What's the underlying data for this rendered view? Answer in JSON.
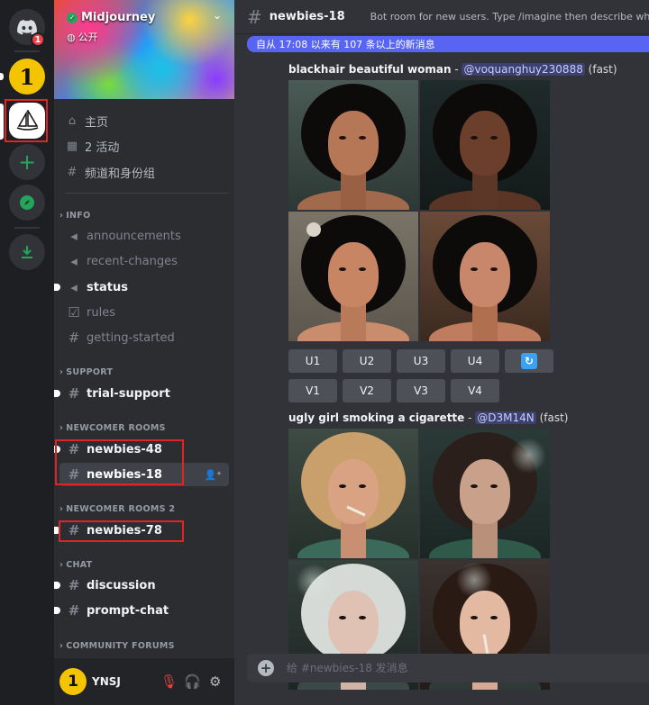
{
  "rail": {
    "home_badge": "1",
    "midjourney_label": "Midjourney",
    "server_one_glyph": "1"
  },
  "sidebar": {
    "server_name": "Midjourney",
    "visibility": "公开",
    "nav": [
      {
        "icon": "home-icon",
        "label": "主页"
      },
      {
        "icon": "calendar-icon",
        "label": "2 活动"
      },
      {
        "icon": "channels-roles-icon",
        "label": "频道和身份组"
      }
    ],
    "categories": {
      "info": "INFO",
      "support": "SUPPORT",
      "newcomer": "NEWCOMER ROOMS",
      "newcomer2": "NEWCOMER ROOMS 2",
      "chat": "CHAT",
      "forums": "COMMUNITY FORUMS"
    },
    "channels": {
      "announcements": "announcements",
      "recent_changes": "recent-changes",
      "status": "status",
      "rules": "rules",
      "getting_started": "getting-started",
      "trial_support": "trial-support",
      "newbies_48": "newbies-48",
      "newbies_18": "newbies-18",
      "newbies_78": "newbies-78",
      "discussion": "discussion",
      "prompt_chat": "prompt-chat"
    },
    "user": {
      "name": "YNSJ",
      "avatar_glyph": "1"
    }
  },
  "main": {
    "channel_title": "newbies-18",
    "topic": "Bot room for new users. Type /imagine then describe what you wa",
    "new_messages_banner": "自从 17:08 以来有 107 条以上的新消息",
    "messages": [
      {
        "prompt": "blackhair beautiful woman",
        "separator": " - ",
        "mention": "@voquanghuy230888",
        "speed": " (fast)"
      },
      {
        "prompt": "ugly girl smoking a cigarette",
        "separator": " - ",
        "mention": "@D3M14N",
        "speed": " (fast)"
      }
    ],
    "upscale_buttons": [
      "U1",
      "U2",
      "U3",
      "U4"
    ],
    "variation_buttons": [
      "V1",
      "V2",
      "V3",
      "V4"
    ],
    "refresh_icon": "refresh-icon",
    "composer_placeholder": "给 #newbies-18 发消息"
  },
  "colors": {
    "rail_bg": "#1e1f22",
    "sidebar_bg": "#2b2d31",
    "chat_bg": "#313338",
    "accent": "#5865f2",
    "highlight": "#e02424",
    "online": "#23a55a"
  }
}
